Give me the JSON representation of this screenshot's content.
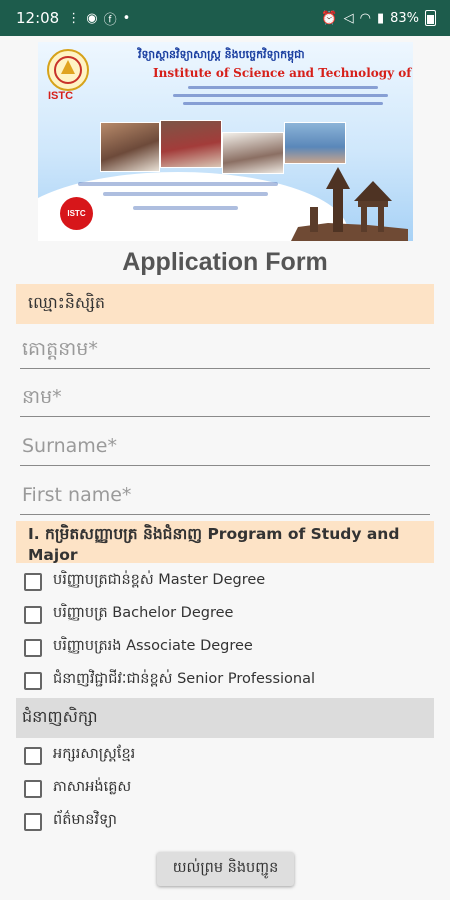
{
  "status_bar": {
    "time": "12:08",
    "battery": "83%"
  },
  "banner": {
    "logo_text": "ISTC",
    "title_km": "វិទ្យាស្ថានវិទ្យាសាស្ត្រ និងបច្ចេកវិទ្យាកម្ពុជា",
    "title_en": "Institute of Science and Technology of Cambodia",
    "badge_text": "ISTC",
    "accent_color": "#d6201a"
  },
  "form": {
    "title": "Application Form",
    "section_student": "ឈ្មោះនិស្សិត",
    "fields": {
      "family_name_km_placeholder": "គោត្តនាម*",
      "given_name_km_placeholder": "នាម*",
      "surname_placeholder": "Surname*",
      "first_name_placeholder": "First name*"
    },
    "section_program": "I. កម្រិតសញ្ញាបត្រ និងជំនាញ Program of Study and Major",
    "degrees": [
      {
        "label": "បរិញ្ញាបត្រជាន់ខ្ពស់ Master Degree",
        "checked": false
      },
      {
        "label": "បរិញ្ញាបត្រ Bachelor Degree",
        "checked": false
      },
      {
        "label": "បរិញ្ញាបត្ររង Associate Degree",
        "checked": false
      },
      {
        "label": "ជំនាញវិជ្ជាជីវៈជាន់ខ្ពស់ Senior Professional",
        "checked": false
      }
    ],
    "section_majors": "ជំនាញសិក្សា",
    "majors": [
      {
        "label": "អក្សរសាស្ត្រខ្មែរ",
        "checked": false
      },
      {
        "label": "ភាសាអង់គ្លេស",
        "checked": false
      },
      {
        "label": "ព័ត៌មានវិទ្យា",
        "checked": false
      }
    ],
    "submit_label": "យល់ព្រម និងបញ្ជូន"
  }
}
